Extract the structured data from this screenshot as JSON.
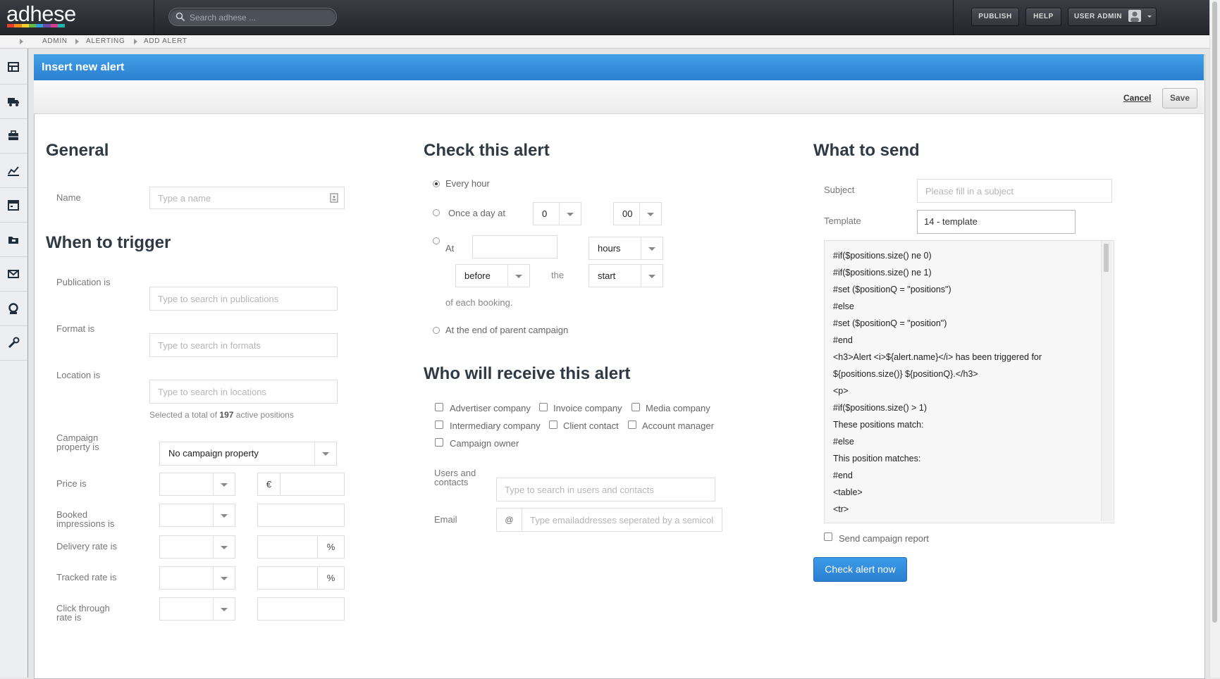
{
  "topbar": {
    "logo": "adhese",
    "logo_colors": [
      "#e8412b",
      "#f28c1c",
      "#f6d02f",
      "#69b843",
      "#2c9fdc",
      "#6e4aa8",
      "#d63d8f",
      "#1db3a6"
    ],
    "search_placeholder": "Search adhese ...",
    "publish_label": "PUBLISH",
    "help_label": "HELP",
    "user_label": "USER ADMIN"
  },
  "breadcrumb": [
    "ADMIN",
    "ALERTING",
    "ADD ALERT"
  ],
  "sidebar": {
    "icons": [
      "dashboard-icon",
      "truck-icon",
      "briefcase-icon",
      "chart-icon",
      "calendar-icon",
      "folder-icon",
      "mail-icon",
      "user-icon",
      "wrench-icon"
    ]
  },
  "panel": {
    "title": "Insert new alert",
    "cancel_label": "Cancel",
    "save_label": "Save"
  },
  "general": {
    "heading": "General",
    "name_label": "Name",
    "name_placeholder": "Type a name"
  },
  "trigger": {
    "heading": "When to trigger",
    "publication_label": "Publication is",
    "publication_placeholder": "Type to search in publications",
    "format_label": "Format is",
    "format_placeholder": "Type to search in formats",
    "location_label": "Location is",
    "location_placeholder": "Type to search in locations",
    "positions_prefix": "Selected a total of",
    "positions_count": "197",
    "positions_suffix": "active positions",
    "campaign_property_label": "Campaign property is",
    "campaign_property_value": "No campaign property",
    "price_label": "Price is",
    "currency_symbol": "€",
    "booked_label": "Booked impressions is",
    "delivery_label": "Delivery rate is",
    "tracked_label": "Tracked rate is",
    "ctr_label": "Click through rate is",
    "percent_symbol": "%"
  },
  "check": {
    "heading": "Check this alert",
    "every_hour": "Every hour",
    "once_a_day": "Once a day at",
    "hour_value": "0",
    "minute_value": "00",
    "at_label": "At",
    "unit_value": "hours",
    "relation_value": "before",
    "the_label": "the",
    "anchor_value": "start",
    "of_each_booking": "of each booking.",
    "end_of_parent": "At the end of parent campaign",
    "selected_option": "Every hour"
  },
  "receivers": {
    "heading": "Who will receive this alert",
    "options": [
      "Advertiser company",
      "Invoice company",
      "Media company",
      "Intermediary company",
      "Client contact",
      "Account manager",
      "Campaign owner"
    ],
    "users_label": "Users and contacts",
    "users_placeholder": "Type to search in users and contacts",
    "email_label": "Email",
    "email_addon": "@",
    "email_placeholder": "Type emailaddresses seperated by a semicolon"
  },
  "send": {
    "heading": "What to send",
    "subject_label": "Subject",
    "subject_placeholder": "Please fill in a subject",
    "template_label": "Template",
    "template_value": "14 - template",
    "template_lines": [
      "#if($positions.size() ne 0)",
      "#if($positions.size() ne 1)",
      "#set ($positionQ = \"positions\")",
      "#else",
      "#set ($positionQ = \"position\")",
      "#end",
      "<h3>Alert <i>${alert.name}</i> has been triggered for",
      "${positions.size()} ${positionQ}.</h3>",
      "<p>",
      "#if($positions.size() > 1)",
      "These positions match:",
      "#else",
      "This position matches:",
      "#end",
      "<table>",
      "<tr>"
    ],
    "campaign_report_label": "Send campaign report",
    "check_now_label": "Check alert now"
  }
}
